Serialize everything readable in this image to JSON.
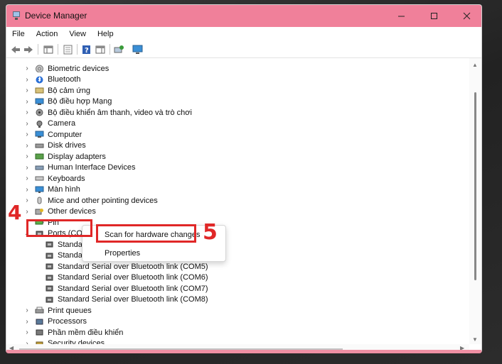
{
  "window": {
    "title": "Device Manager"
  },
  "menu": [
    "File",
    "Action",
    "View",
    "Help"
  ],
  "tree": [
    {
      "label": "Biometric devices",
      "icon": "fingerprint-icon",
      "expanded": false
    },
    {
      "label": "Bluetooth",
      "icon": "bluetooth-icon",
      "expanded": false
    },
    {
      "label": "Bộ cảm ứng",
      "icon": "sensor-icon",
      "expanded": false
    },
    {
      "label": "Bộ điều hợp Mạng",
      "icon": "network-adapter-icon",
      "expanded": false
    },
    {
      "label": "Bộ điều khiển âm thanh, video và trò chơi",
      "icon": "sound-icon",
      "expanded": false
    },
    {
      "label": "Camera",
      "icon": "camera-icon",
      "expanded": false
    },
    {
      "label": "Computer",
      "icon": "computer-icon",
      "expanded": false
    },
    {
      "label": "Disk drives",
      "icon": "disk-drive-icon",
      "expanded": false
    },
    {
      "label": "Display adapters",
      "icon": "display-adapter-icon",
      "expanded": false
    },
    {
      "label": "Human Interface Devices",
      "icon": "hid-icon",
      "expanded": false
    },
    {
      "label": "Keyboards",
      "icon": "keyboard-icon",
      "expanded": false
    },
    {
      "label": "Màn hình",
      "icon": "monitor-icon",
      "expanded": false
    },
    {
      "label": "Mice and other pointing devices",
      "icon": "mouse-icon",
      "expanded": false
    },
    {
      "label": "Other devices",
      "icon": "other-devices-icon",
      "expanded": false
    },
    {
      "label": "Pin",
      "icon": "battery-icon",
      "expanded": false
    },
    {
      "label": "Ports (COM",
      "icon": "port-icon",
      "expanded": true
    },
    {
      "label": "Standar",
      "icon": "port-icon",
      "child": true
    },
    {
      "label": "Standar",
      "icon": "port-icon",
      "child": true
    },
    {
      "label": "Standard Serial over Bluetooth link (COM5)",
      "icon": "port-icon",
      "child": true
    },
    {
      "label": "Standard Serial over Bluetooth link (COM6)",
      "icon": "port-icon",
      "child": true
    },
    {
      "label": "Standard Serial over Bluetooth link (COM7)",
      "icon": "port-icon",
      "child": true
    },
    {
      "label": "Standard Serial over Bluetooth link (COM8)",
      "icon": "port-icon",
      "child": true
    },
    {
      "label": "Print queues",
      "icon": "printer-icon",
      "expanded": false
    },
    {
      "label": "Processors",
      "icon": "processor-icon",
      "expanded": false
    },
    {
      "label": "Phần mềm điều khiển",
      "icon": "firmware-icon",
      "expanded": false
    },
    {
      "label": "Security devices",
      "icon": "security-icon",
      "expanded": false
    }
  ],
  "context_menu": {
    "scan": "Scan for hardware changes",
    "properties": "Properties"
  },
  "annotations": {
    "step4": "4",
    "step5": "5"
  },
  "colors": {
    "titlebar": "#f0809a",
    "annotation": "#e02727"
  }
}
